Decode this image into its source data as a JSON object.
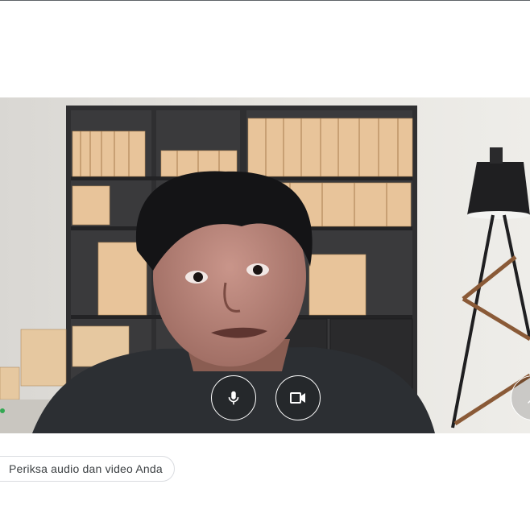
{
  "preview": {
    "mic_icon": "microphone-icon",
    "camera_icon": "videocam-icon",
    "effects_icon": "visual-effects-icon"
  },
  "actions": {
    "check_audio_video_label": "Periksa audio dan video Anda"
  },
  "colors": {
    "control_border": "#ffffff",
    "button_border": "#dadce0",
    "button_text": "#3c4043"
  }
}
